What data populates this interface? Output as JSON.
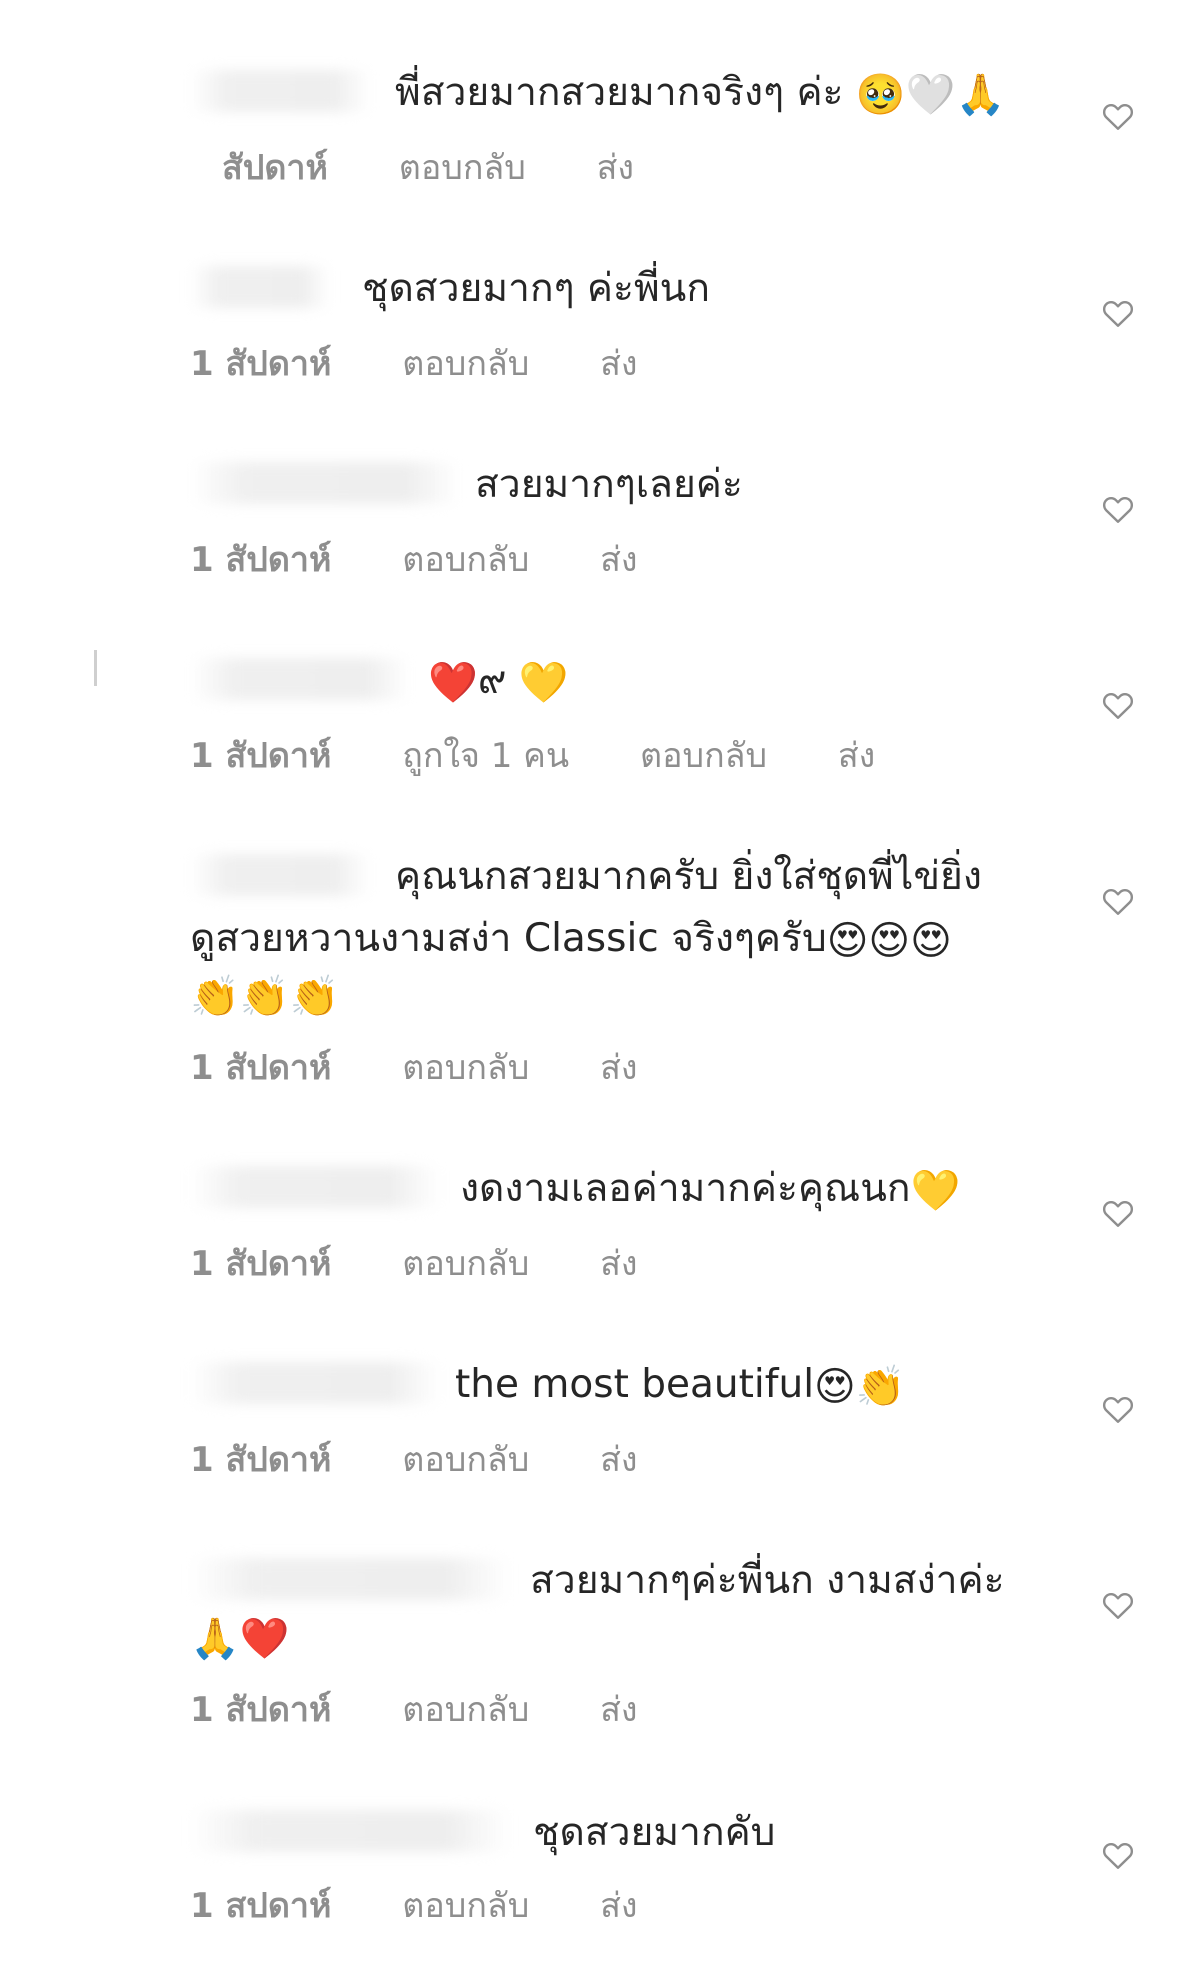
{
  "comments": [
    {
      "text": "พี่สวยมากสวยมากจริงๆ ค่ะ",
      "emojis": "🥹🤍🙏",
      "time": "สัปดาห์",
      "reply": "ตอบกลับ",
      "send": "ส่ง"
    },
    {
      "text": "ชุดสวยมากๆ ค่ะพี่นก",
      "emojis": "",
      "time": "1 สัปดาห์",
      "reply": "ตอบกลับ",
      "send": "ส่ง"
    },
    {
      "text": "สวยมากๆเลยค่ะ",
      "emojis": "",
      "time": "1 สัปดาห์",
      "reply": "ตอบกลับ",
      "send": "ส่ง"
    },
    {
      "text": "๙",
      "emoji_before": "❤️",
      "emojis": "💛",
      "time": "1 สัปดาห์",
      "likes": "ถูกใจ 1 คน",
      "reply": "ตอบกลับ",
      "send": "ส่ง"
    },
    {
      "text_line1": "คุณนกสวยมากครับ ยิ่งใส่ชุดพี่ไข่ยิ่ง",
      "text_line2": "ดูสวยหวานงามสง่า Classic จริงๆครับ",
      "emojis_line2": "😍😍😍",
      "emojis_line3": "👏👏👏",
      "time": "1 สัปดาห์",
      "reply": "ตอบกลับ",
      "send": "ส่ง"
    },
    {
      "text": "งดงามเลอค่ามากค่ะคุณนก",
      "emojis": "💛",
      "time": "1 สัปดาห์",
      "reply": "ตอบกลับ",
      "send": "ส่ง"
    },
    {
      "text": "the most beautiful",
      "emojis": "😍👏",
      "time": "1 สัปดาห์",
      "reply": "ตอบกลับ",
      "send": "ส่ง"
    },
    {
      "text": "สวยมากๆค่ะพี่นก งามสง่าค่ะ",
      "emojis_line2": "🙏❤️",
      "time": "1 สัปดาห์",
      "reply": "ตอบกลับ",
      "send": "ส่ง"
    },
    {
      "text": "ชุดสวยมากคับ",
      "emojis": "",
      "time": "1 สปดาห์",
      "reply": "ตอบกลับ",
      "send": "ส่ง"
    }
  ],
  "icons": {
    "like": "heart-outline-icon"
  },
  "colors": {
    "text": "#262626",
    "meta": "#8e8e8e",
    "heart_stroke": "#8e8e8e"
  }
}
